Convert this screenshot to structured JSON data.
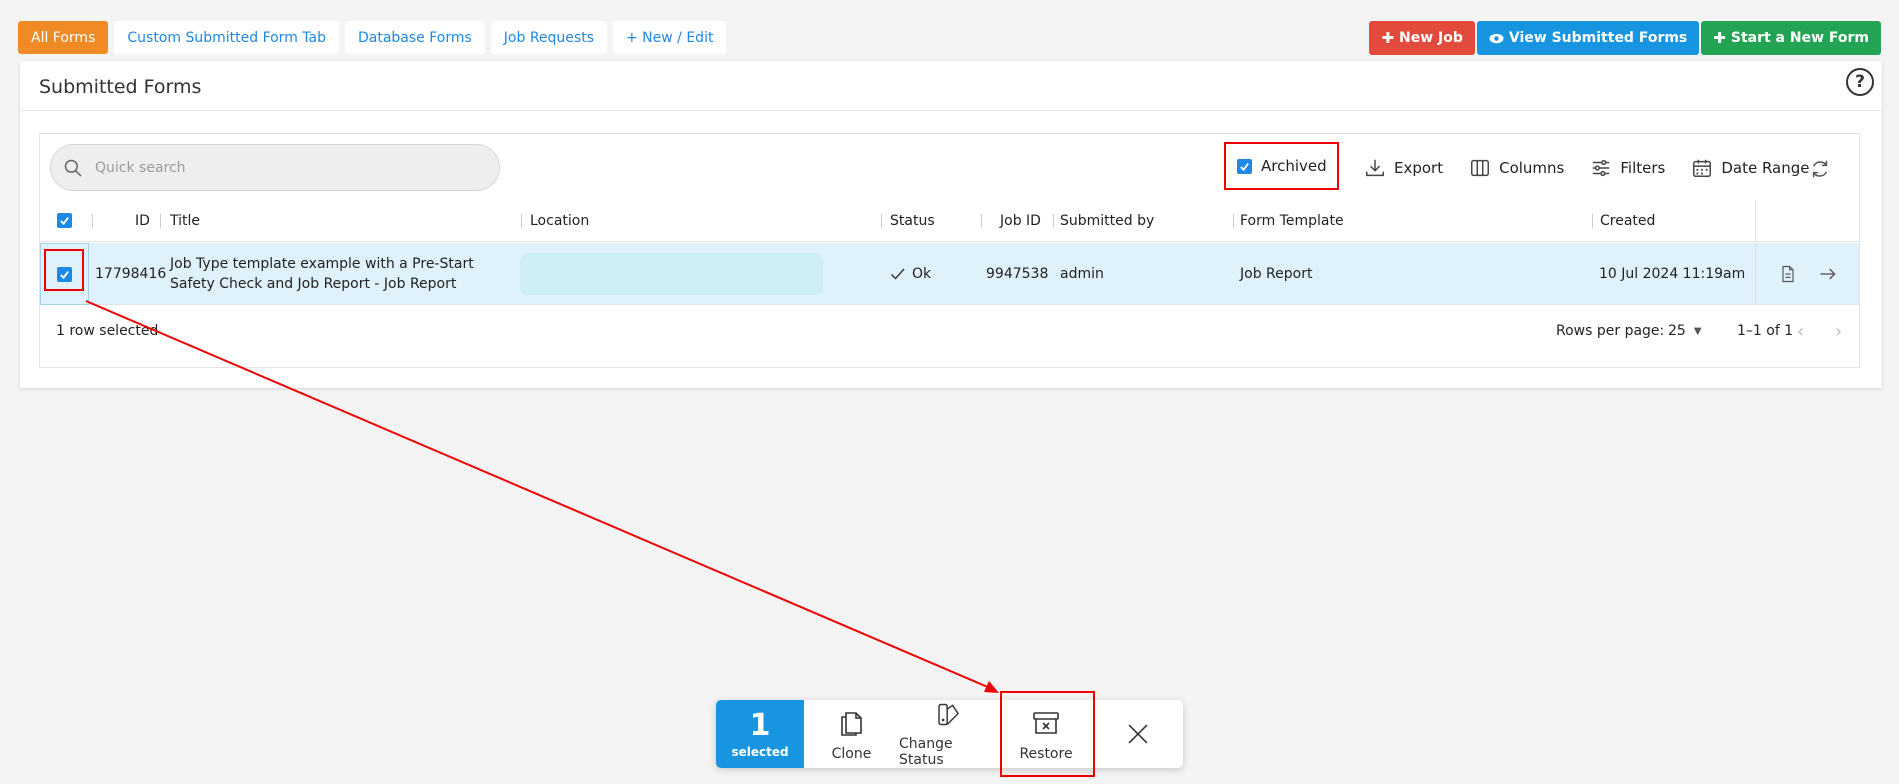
{
  "tabs": [
    {
      "label": "All Forms",
      "active": true
    },
    {
      "label": "Custom Submitted Form Tab"
    },
    {
      "label": "Database Forms"
    },
    {
      "label": "Job Requests"
    },
    {
      "label": "+ New / Edit"
    }
  ],
  "top_actions": {
    "new_job": "New Job",
    "view_submitted": "View Submitted Forms",
    "start_new_form": "Start a New Form"
  },
  "panel": {
    "title": "Submitted Forms",
    "help": "?"
  },
  "search": {
    "placeholder": "Quick search"
  },
  "toolbar": {
    "archived": "Archived",
    "export": "Export",
    "columns": "Columns",
    "filters": "Filters",
    "date_range": "Date Range"
  },
  "columns": {
    "id": "ID",
    "title": "Title",
    "location": "Location",
    "status": "Status",
    "job_id": "Job ID",
    "submitted_by": "Submitted by",
    "form_template": "Form Template",
    "created": "Created"
  },
  "row": {
    "id": "17798416",
    "title": "Job Type template example with a Pre-Start Safety Check and Job Report - Job Report",
    "status": "Ok",
    "job_id": "9947538",
    "submitted_by": "admin",
    "form_template": "Job Report",
    "created": "10 Jul 2024 11:19am"
  },
  "footer": {
    "selected_text": "1 row selected",
    "rows_per_page_label": "Rows per page:",
    "rows_per_page": "25",
    "range": "1–1 of 1"
  },
  "bulk_bar": {
    "count": "1",
    "count_label": "selected",
    "clone": "Clone",
    "change_status": "Change Status",
    "restore": "Restore"
  },
  "colors": {
    "accent_orange": "#f08a24",
    "accent_blue": "#1795e0",
    "red": "#e24a3b",
    "green": "#23a455",
    "annotation_red": "#ee0000"
  }
}
